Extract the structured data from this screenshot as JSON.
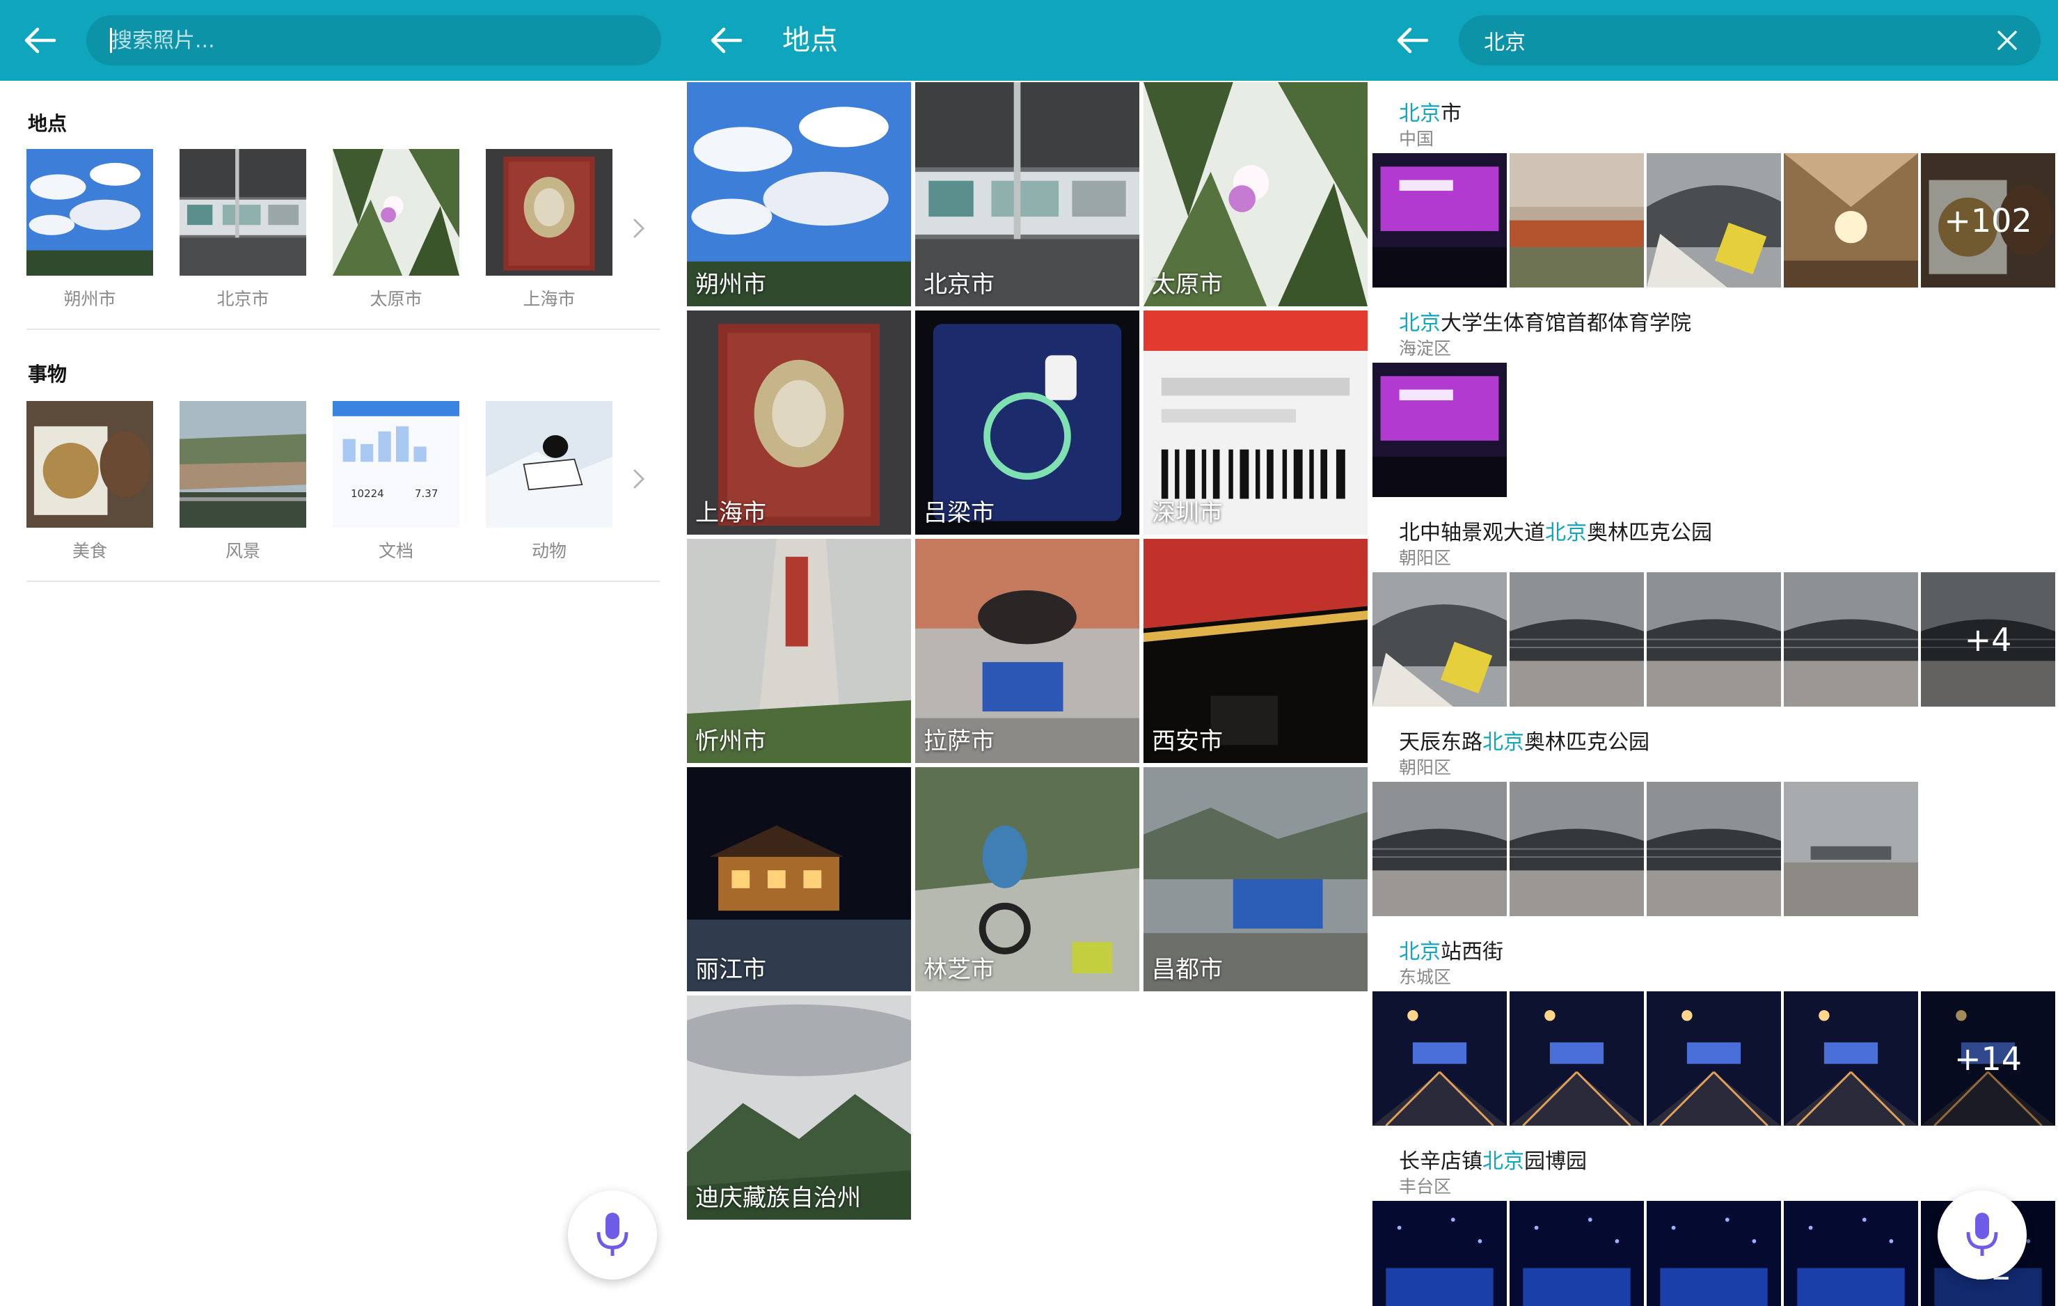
{
  "search_panel": {
    "search": {
      "placeholder": "搜索照片..."
    },
    "places_section": {
      "title": "地点",
      "items": [
        {
          "label": "朔州市",
          "scene": "sky"
        },
        {
          "label": "北京市",
          "scene": "subway"
        },
        {
          "label": "太原市",
          "scene": "trees"
        },
        {
          "label": "上海市",
          "scene": "book"
        }
      ]
    },
    "things_section": {
      "title": "事物",
      "items": [
        {
          "label": "美食",
          "scene": "food"
        },
        {
          "label": "风景",
          "scene": "river"
        },
        {
          "label": "文档",
          "scene": "doc",
          "doc_values": [
            "10224",
            "7.37"
          ]
        },
        {
          "label": "动物",
          "scene": "ski"
        }
      ]
    }
  },
  "places_panel": {
    "title": "地点",
    "places": [
      {
        "label": "朔州市",
        "scene": "sky"
      },
      {
        "label": "北京市",
        "scene": "subway"
      },
      {
        "label": "太原市",
        "scene": "trees"
      },
      {
        "label": "上海市",
        "scene": "book"
      },
      {
        "label": "吕梁市",
        "scene": "charger"
      },
      {
        "label": "深圳市",
        "scene": "badge"
      },
      {
        "label": "忻州市",
        "scene": "monument"
      },
      {
        "label": "拉萨市",
        "scene": "yak"
      },
      {
        "label": "西安市",
        "scene": "citygate"
      },
      {
        "label": "丽江市",
        "scene": "nightvillage"
      },
      {
        "label": "林芝市",
        "scene": "cyclist"
      },
      {
        "label": "昌都市",
        "scene": "group"
      },
      {
        "label": "迪庆藏族自治州",
        "scene": "mountain"
      }
    ]
  },
  "results_panel": {
    "query": "北京",
    "groups": [
      {
        "pre": "",
        "hl": "北京",
        "post": "市",
        "sub": "中国",
        "photos": [
          "stage",
          "city",
          "stadium",
          "lamp",
          "food"
        ],
        "more": "+102"
      },
      {
        "pre": "",
        "hl": "北京",
        "post": "大学生体育馆首都体育学院",
        "sub": "海淀区",
        "photos": [
          "stage"
        ],
        "more": ""
      },
      {
        "pre": "北中轴景观大道",
        "hl": "北京",
        "post": "奥林匹克公园",
        "sub": "朝阳区",
        "photos": [
          "stadium",
          "nest",
          "nest",
          "nest",
          "nest"
        ],
        "more": "+4"
      },
      {
        "pre": "天辰东路",
        "hl": "北京",
        "post": "奥林匹克公园",
        "sub": "朝阳区",
        "photos": [
          "nest",
          "nest",
          "nest",
          "plaza"
        ],
        "more": ""
      },
      {
        "pre": "",
        "hl": "北京",
        "post": "站西街",
        "sub": "东城区",
        "photos": [
          "night",
          "night",
          "night",
          "night",
          "night"
        ],
        "more": "+14"
      },
      {
        "pre": "长辛店镇",
        "hl": "北京",
        "post": "园博园",
        "sub": "丰台区",
        "photos": [
          "event",
          "event",
          "event",
          "event",
          "event"
        ],
        "more": "+2"
      }
    ]
  },
  "colors": {
    "accent": "#0fa6bd",
    "search_field": "#0c93a8",
    "mic": "#6c5ce7"
  },
  "icons": {
    "back": "arrow-left-icon",
    "clear": "close-icon",
    "mic": "microphone-icon",
    "chevron": "chevron-right-icon"
  }
}
